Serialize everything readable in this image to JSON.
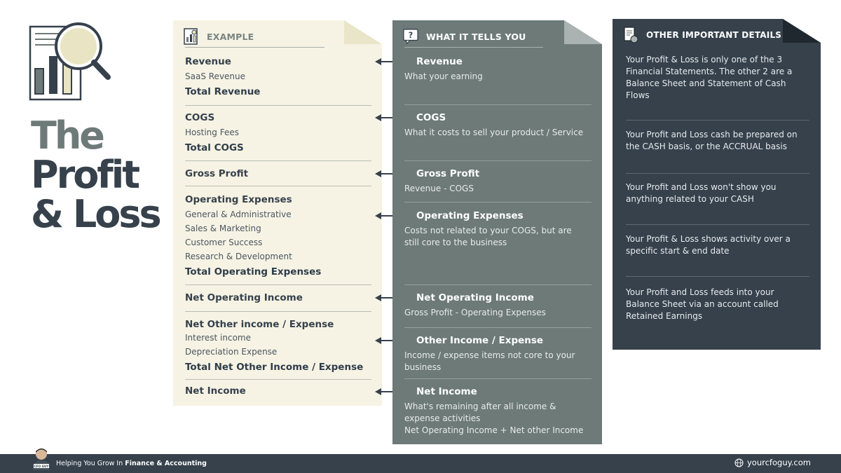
{
  "title": {
    "line1": "The",
    "line2": "Profit",
    "line3": "& Loss"
  },
  "example": {
    "header": "EXAMPLE",
    "icon": "report-chart-icon",
    "rows": {
      "revenue_head": "Revenue",
      "saas_revenue": "SaaS Revenue",
      "total_revenue": "Total Revenue",
      "cogs_head": "COGS",
      "hosting_fees": "Hosting Fees",
      "total_cogs": "Total COGS",
      "gross_profit": "Gross Profit",
      "opex_head": "Operating Expenses",
      "ga": "General & Administrative",
      "sales_marketing": "Sales & Marketing",
      "customer_success": "Customer Success",
      "rnd": "Research & Development",
      "total_opex": "Total Operating Expenses",
      "net_operating_income": "Net Operating Income",
      "other_head": "Net Other income / Expense",
      "interest_income": "Interest income",
      "depreciation": "Depreciation Expense",
      "total_other": "Total Net Other Income / Expense",
      "net_income": "Net Income"
    }
  },
  "tells": {
    "header": "WHAT IT TELLS YOU",
    "icon": "question-bubble-icon",
    "items": [
      {
        "head": "Revenue",
        "desc": "What your earning"
      },
      {
        "head": "COGS",
        "desc": "What it costs to sell your product / Service"
      },
      {
        "head": "Gross Profit",
        "desc": "Revenue - COGS"
      },
      {
        "head": "Operating Expenses",
        "desc": "Costs not related to your COGS, but are still core to the business"
      },
      {
        "head": "Net Operating Income",
        "desc": "Gross Profit - Operating Expenses"
      },
      {
        "head": "Other Income / Expense",
        "desc": "Income / expense items not core to your business"
      },
      {
        "head": "Net Income",
        "desc": "What's remaining after all income & expense activities",
        "desc2": "Net Operating Income + Net other Income"
      }
    ]
  },
  "details": {
    "header": "OTHER IMPORTANT DETAILS",
    "icon": "document-coin-icon",
    "items": [
      "Your Profit & Loss is only one of the 3 Financial Statements. The other 2 are a Balance Sheet and Statement of Cash Flows",
      "Your Profit and Loss cash be prepared on the CASH basis, or the ACCRUAL basis",
      "Your Profit and Loss won't show you anything related to your CASH",
      "Your Profit & Loss shows activity over a specific start & end date",
      "Your Profit and Loss feeds into your Balance Sheet via an account called Retained Earnings"
    ]
  },
  "footer": {
    "tagline_prefix": "Helping You Grow In ",
    "tagline_bold": "Finance & Accounting",
    "site": "yourcfoguy.com",
    "avatar_badge": "CFO GUY"
  },
  "colors": {
    "dark": "#36414c",
    "slate": "#6d7a78",
    "cream": "#f6f3e4",
    "white": "#ffffff"
  }
}
